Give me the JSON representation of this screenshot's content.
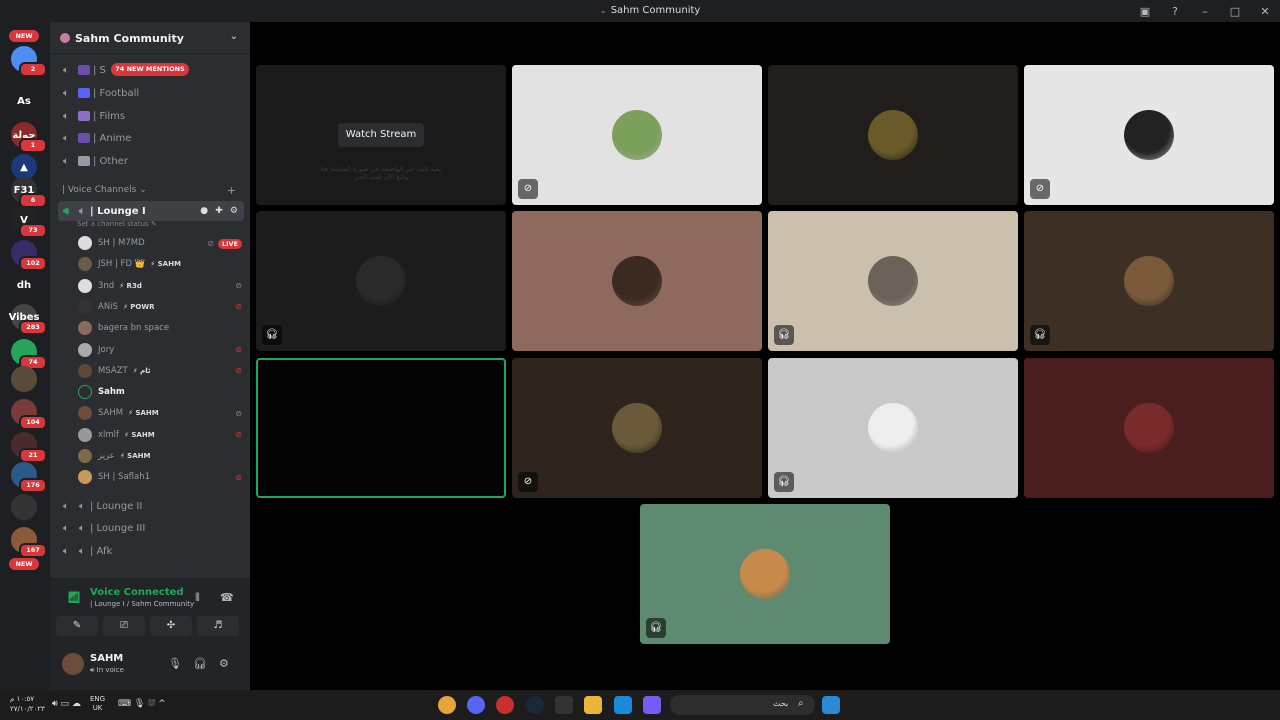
{
  "window": {
    "title": "Sahm Community",
    "controls": [
      "pin-icon",
      "help-icon",
      "minimize-icon",
      "maximize-icon",
      "close-icon"
    ]
  },
  "rail": {
    "servers": [
      {
        "label": "",
        "color": "#4e8df5",
        "badge": "2"
      },
      {
        "label": "As",
        "color": "#1e1f22",
        "badge": ""
      },
      {
        "label": "حولة",
        "color": "#8b2a2a",
        "badge": "1"
      },
      {
        "label": "▲",
        "color": "#1a3a7a",
        "badge": ""
      },
      {
        "label": "F31",
        "color": "#333",
        "badge": "6"
      },
      {
        "label": "V",
        "color": "#222",
        "badge": "73"
      },
      {
        "label": "",
        "color": "#3b2a6a",
        "badge": "102"
      },
      {
        "label": "dh",
        "color": "#1e1f22",
        "badge": ""
      },
      {
        "label": "Vibes",
        "color": "#444",
        "badge": "283"
      },
      {
        "label": "",
        "color": "#23a55a",
        "badge": "74"
      },
      {
        "label": "",
        "color": "#5a4a3a",
        "badge": ""
      },
      {
        "label": "",
        "color": "#7a3a3a",
        "badge": "104"
      },
      {
        "label": "",
        "color": "#4a2a2a",
        "badge": "21"
      },
      {
        "label": "",
        "color": "#2a5a8a",
        "badge": "176"
      },
      {
        "label": "",
        "color": "#333",
        "badge": ""
      },
      {
        "label": "",
        "color": "#8a5a3a",
        "badge": "167"
      }
    ],
    "new_top": "NEW",
    "new_bottom": "NEW"
  },
  "sidebar": {
    "server_name": "Sahm Community",
    "mentions_pill": "74 NEW MENTIONS",
    "text_channels": [
      {
        "label": "| S",
        "emoji_color": "#6b4fa8"
      },
      {
        "label": "| Football",
        "emoji_color": "#5865f2"
      },
      {
        "label": "| Films",
        "emoji_color": "#8e6fc7"
      },
      {
        "label": "| Anime",
        "emoji_color": "#6b4fa8"
      },
      {
        "label": "| Other",
        "emoji_color": "#949ba4"
      }
    ],
    "category": "| Voice Channels",
    "active_channel": {
      "label": "| Lounge I",
      "status_hint": "Set a channel status"
    },
    "voice_users": [
      {
        "name": "SH | M7MD",
        "tag": "",
        "right": "live",
        "avatar": "#dcdcdc"
      },
      {
        "name": "JSH | FD 👑",
        "tag": "⚡ SAHM",
        "right": "",
        "avatar": "#6a5a4a"
      },
      {
        "name": "3nd",
        "tag": "⚡ R3d",
        "right": "mute-gray",
        "avatar": "#ddd"
      },
      {
        "name": "ANiS",
        "tag": "⚡ POWR",
        "right": "mute-red",
        "avatar": "#333"
      },
      {
        "name": "bagera bn space",
        "tag": "",
        "right": "",
        "avatar": "#8a6a5a"
      },
      {
        "name": "Jory",
        "tag": "",
        "right": "mute-red",
        "avatar": "#aaa"
      },
      {
        "name": "MSAZT",
        "tag": "⚡ ٹام",
        "right": "mute-red",
        "avatar": "#5a4a3a"
      },
      {
        "name": "Sahm",
        "tag": "",
        "right": "",
        "avatar": "",
        "me": true
      },
      {
        "name": "SAHM",
        "tag": "⚡ SAHM",
        "right": "mute-gray",
        "avatar": "#6d4c3a"
      },
      {
        "name": "xlmlf",
        "tag": "⚡ SAHM",
        "right": "mute-red",
        "avatar": "#999"
      },
      {
        "name": "عزيز",
        "tag": "⚡ SAHM",
        "right": "",
        "avatar": "#7a6a4a"
      },
      {
        "name": "SH | Saflah1",
        "tag": "",
        "right": "mute-red",
        "avatar": "#c89a5a"
      }
    ],
    "other_channels": [
      "| Lounge II",
      "| Lounge III",
      "| Afk"
    ],
    "live_label": "LIVE"
  },
  "voice_panel": {
    "title": "Voice Connected",
    "subtitle": "| Lounge I / Sahm Community",
    "buttons": [
      "camera-off-icon",
      "screen-share-icon",
      "activities-icon",
      "soundboard-icon"
    ]
  },
  "user_panel": {
    "name": "SAHM",
    "status": "In voice"
  },
  "grid": {
    "watch_stream": "Watch Stream",
    "ghost_line1": "بقية البث غير الواضحة في صورة الشاشة هنا",
    "ghost_line2": "وتابع الآن للبث الحي",
    "tiles": [
      {
        "bg": "#1a1a1a",
        "avatar": "",
        "mute": false,
        "stream": true
      },
      {
        "bg": "#e2e2e2",
        "avatar": "#7aa05a",
        "mute": true
      },
      {
        "bg": "#201d1a",
        "avatar": "#6a5a2a",
        "mute": false
      },
      {
        "bg": "#e6e6e6",
        "avatar": "#222",
        "mute": true
      },
      {
        "bg": "#1c1c1c",
        "avatar": "#2a2a2a",
        "mute": "deafen"
      },
      {
        "bg": "#8d6a5d",
        "avatar": "#3a2a22",
        "mute": false
      },
      {
        "bg": "#cbbfae",
        "avatar": "#6a6258",
        "mute": "deafen"
      },
      {
        "bg": "#3d2f24",
        "avatar": "#7a5a3a",
        "mute": "deafen"
      },
      {
        "bg": "#050505",
        "avatar": "",
        "mute": false,
        "speaking": true
      },
      {
        "bg": "#2e241d",
        "avatar": "#6a5a3a",
        "mute": true
      },
      {
        "bg": "#c9c9c9",
        "avatar": "#eeeeee",
        "mute": "deafen"
      },
      {
        "bg": "#4a1e1e",
        "avatar": "#7a2a2a",
        "mute": false
      },
      {
        "bg": "#5e8a72",
        "avatar": "#c88a4a",
        "mute": "deafen"
      }
    ]
  },
  "taskbar": {
    "time_line1": "١٠:٥٧ م",
    "time_line2": "٢٧/١٠/٢٠٢٣",
    "lang_line1": "ENG",
    "lang_line2": "UK",
    "search_label": "بحث",
    "apps": [
      "chrome-icon",
      "discord-icon",
      "app-icon",
      "steam-icon",
      "store-icon",
      "explorer-icon",
      "edge-icon",
      "copilot-icon",
      "windows-icon"
    ]
  },
  "colors": {
    "accent_green": "#23a55a",
    "badge_red": "#da373c",
    "sidebar_bg": "#2b2d31",
    "rail_bg": "#1e1f22"
  }
}
